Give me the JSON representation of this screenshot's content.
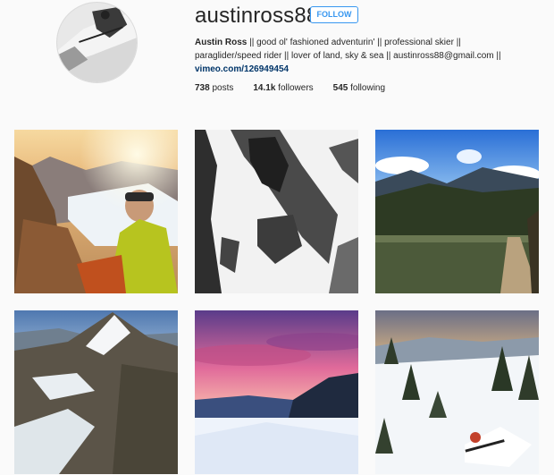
{
  "profile": {
    "username": "austinross88",
    "follow_label": "FOLLOW",
    "full_name": "Austin Ross",
    "bio_line1": " || good ol' fashioned adventurin' || professional skier ||",
    "bio_line2": "paraglider/speed rider || lover of land, sky & sea || austinross88@gmail.com ||",
    "website": "vimeo.com/126949454",
    "avatar_icon": "profile-photo-skier"
  },
  "stats": {
    "posts_count": "738",
    "posts_label": " posts",
    "followers_count": "14.1k",
    "followers_label": " followers",
    "following_count": "545",
    "following_label": " following"
  },
  "colors": {
    "accent": "#3897f0",
    "link": "#003569",
    "background": "#fafafa"
  },
  "posts": [
    {
      "subject": "selfie-sunset-glacier"
    },
    {
      "subject": "snowy-rock-face-bw"
    },
    {
      "subject": "alpine-lake-boardwalk"
    },
    {
      "subject": "glacier-peak-aerial"
    },
    {
      "subject": "pink-sunset-over-clouds"
    },
    {
      "subject": "powder-skier-trees"
    }
  ]
}
